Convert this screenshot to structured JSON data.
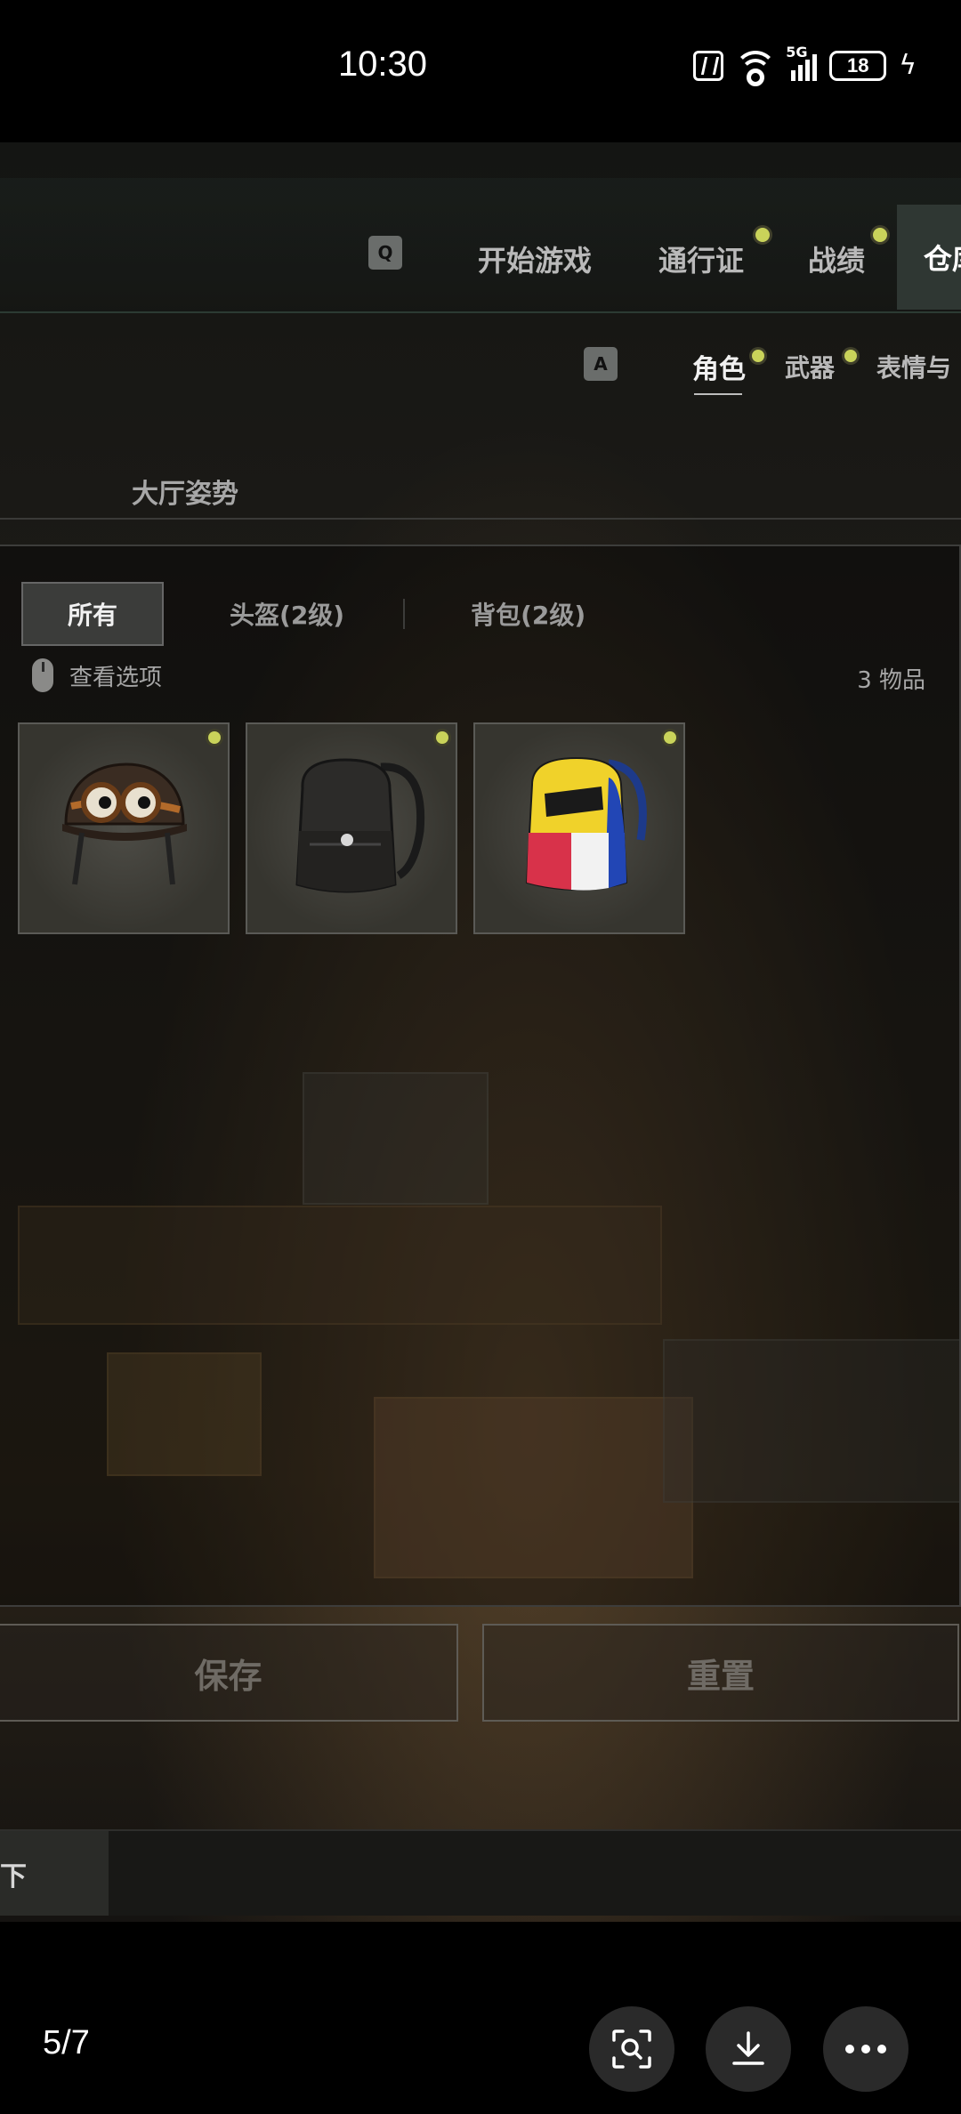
{
  "status_bar": {
    "time": "10:30",
    "network_label": "5G",
    "battery": "18"
  },
  "top_nav": {
    "key_hint": "Q",
    "items": [
      {
        "label": "开始游戏",
        "has_dot": false
      },
      {
        "label": "通行证",
        "has_dot": true
      },
      {
        "label": "战绩",
        "has_dot": true
      },
      {
        "label": "仓库",
        "active": true
      }
    ]
  },
  "sub_nav": {
    "key_hint": "A",
    "items": [
      {
        "label": "角色",
        "active": true,
        "has_dot": true
      },
      {
        "label": "武器",
        "has_dot": true
      },
      {
        "label": "表情与"
      }
    ],
    "section_title": "大厅姿势"
  },
  "filters": {
    "tabs": [
      "所有",
      "头盔(2级)",
      "背包(2级)"
    ],
    "active_index": 0,
    "view_options_label": "查看选项",
    "item_count": "3 物品"
  },
  "items": [
    {
      "name": "goggles-helmet",
      "new": true
    },
    {
      "name": "black-backpack",
      "new": true
    },
    {
      "name": "colorful-backpack",
      "new": true
    }
  ],
  "actions": {
    "save_label": "保存",
    "reset_label": "重置"
  },
  "bottom_bar": {
    "cut_label": "卸下"
  },
  "viewer": {
    "page_indicator": "5/7"
  },
  "colors": {
    "new_dot": "#c9d35a",
    "panel_border": "#3d3d3b",
    "active_tab_bg": "#3b3c3a"
  }
}
